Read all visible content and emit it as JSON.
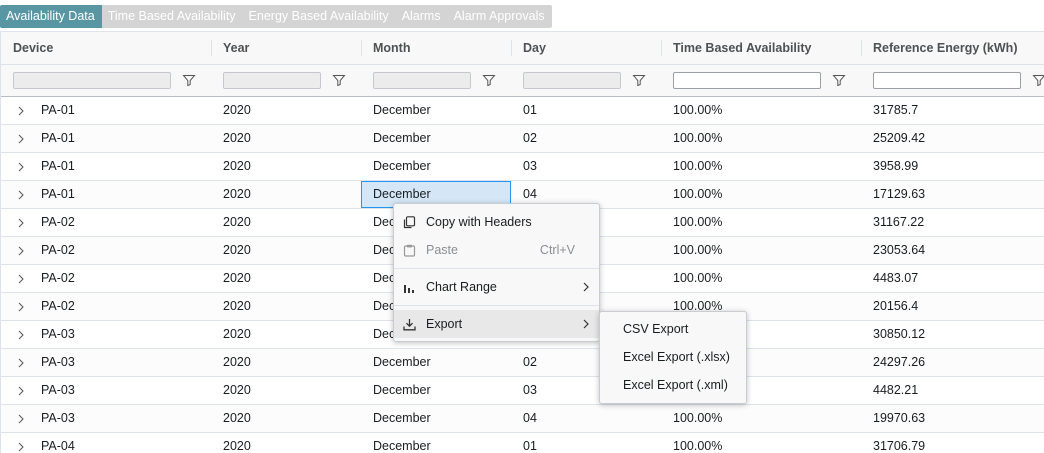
{
  "tabs": [
    {
      "label": "Availability Data",
      "active": true
    },
    {
      "label": "Time Based Availability",
      "active": false
    },
    {
      "label": "Energy Based Availability",
      "active": false
    },
    {
      "label": "Alarms",
      "active": false
    },
    {
      "label": "Alarm Approvals",
      "active": false
    }
  ],
  "columns": [
    "Device",
    "Year",
    "Month",
    "Day",
    "Time Based Availability",
    "Reference Energy (kWh)"
  ],
  "rows": [
    [
      "PA-01",
      "2020",
      "December",
      "01",
      "100.00%",
      "31785.7"
    ],
    [
      "PA-01",
      "2020",
      "December",
      "02",
      "100.00%",
      "25209.42"
    ],
    [
      "PA-01",
      "2020",
      "December",
      "03",
      "100.00%",
      "3958.99"
    ],
    [
      "PA-01",
      "2020",
      "December",
      "04",
      "100.00%",
      "17129.63"
    ],
    [
      "PA-02",
      "2020",
      "Dec",
      "",
      "100.00%",
      "31167.22"
    ],
    [
      "PA-02",
      "2020",
      "Dec",
      "",
      "100.00%",
      "23053.64"
    ],
    [
      "PA-02",
      "2020",
      "Dec",
      "",
      "100.00%",
      "4483.07"
    ],
    [
      "PA-02",
      "2020",
      "Dec",
      "",
      "100.00%",
      "20156.4"
    ],
    [
      "PA-03",
      "2020",
      "Dec",
      "",
      "",
      "30850.12"
    ],
    [
      "PA-03",
      "2020",
      "December",
      "02",
      "",
      "24297.26"
    ],
    [
      "PA-03",
      "2020",
      "December",
      "03",
      "",
      "4482.21"
    ],
    [
      "PA-03",
      "2020",
      "December",
      "04",
      "100.00%",
      "19970.63"
    ],
    [
      "PA-04",
      "2020",
      "December",
      "01",
      "100.00%",
      "31706.79"
    ]
  ],
  "context_menu": {
    "copy_with_headers": "Copy with Headers",
    "paste": "Paste",
    "paste_shortcut": "Ctrl+V",
    "chart_range": "Chart Range",
    "export": "Export"
  },
  "export_submenu": {
    "csv": "CSV Export",
    "xlsx": "Excel Export (.xlsx)",
    "xml": "Excel Export (.xml)"
  },
  "icons": {
    "expander": "chevron-right-icon",
    "filter": "filter-icon",
    "copy": "copy-icon",
    "paste": "paste-icon",
    "chart": "bar-chart-icon",
    "export": "download-icon"
  },
  "colors": {
    "active_tab": "#5996a3",
    "inactive_tabs": "#d4d4d4",
    "selection": "#2196f3"
  }
}
